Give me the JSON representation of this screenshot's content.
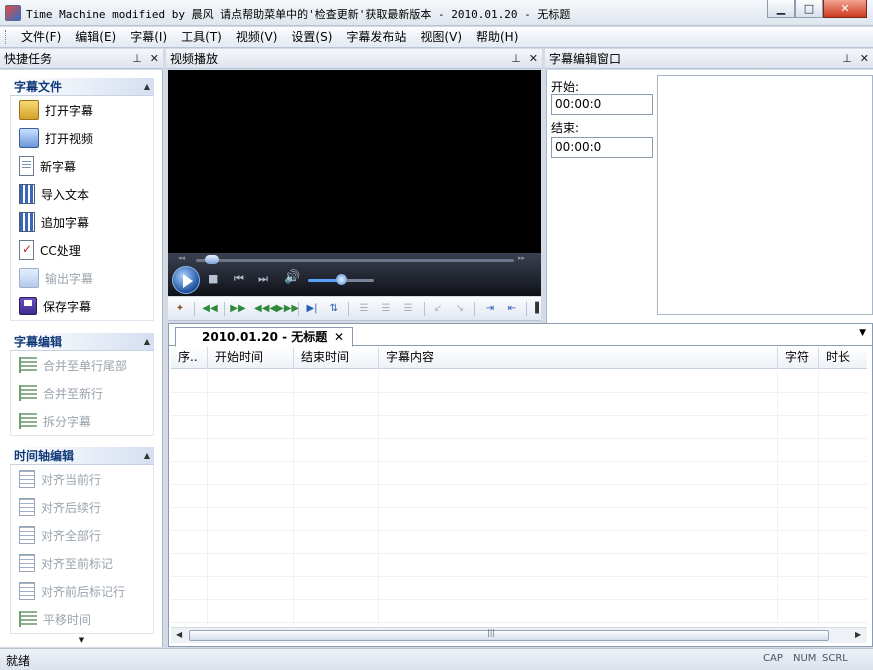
{
  "window": {
    "title": "Time Machine modified by 晨风 请点帮助菜单中的'检查更新'获取最新版本 - 2010.01.20 - 无标题"
  },
  "menu": [
    "文件(F)",
    "编辑(E)",
    "字幕(I)",
    "工具(T)",
    "视频(V)",
    "设置(S)",
    "字幕发布站",
    "视图(V)",
    "帮助(H)"
  ],
  "panes": {
    "tasks_title": "快捷任务",
    "video_title": "视频播放",
    "edit_title": "字幕编辑窗口"
  },
  "task_groups": [
    {
      "title": "字幕文件",
      "items": [
        {
          "label": "打开字幕",
          "icon": "open-subtitle-icon",
          "enabled": true
        },
        {
          "label": "打开视频",
          "icon": "open-video-icon",
          "enabled": true
        },
        {
          "label": "新字幕",
          "icon": "new-subtitle-icon",
          "enabled": true
        },
        {
          "label": "导入文本",
          "icon": "import-text-icon",
          "enabled": true
        },
        {
          "label": "追加字幕",
          "icon": "append-subtitle-icon",
          "enabled": true
        },
        {
          "label": "CC处理",
          "icon": "cc-process-icon",
          "enabled": true
        },
        {
          "label": "输出字幕",
          "icon": "export-subtitle-icon",
          "enabled": false
        },
        {
          "label": "保存字幕",
          "icon": "save-icon",
          "enabled": true
        }
      ]
    },
    {
      "title": "字幕编辑",
      "items": [
        {
          "label": "合并至单行尾部",
          "icon": "merge-line-end-icon",
          "enabled": false
        },
        {
          "label": "合并至新行",
          "icon": "merge-new-line-icon",
          "enabled": false
        },
        {
          "label": "拆分字幕",
          "icon": "split-subtitle-icon",
          "enabled": false
        }
      ]
    },
    {
      "title": "时间轴编辑",
      "items": [
        {
          "label": "对齐当前行",
          "icon": "align-current-icon",
          "enabled": false
        },
        {
          "label": "对齐后续行",
          "icon": "align-following-icon",
          "enabled": false
        },
        {
          "label": "对齐全部行",
          "icon": "align-all-icon",
          "enabled": false
        },
        {
          "label": "对齐至前标记",
          "icon": "align-prev-mark-icon",
          "enabled": false
        },
        {
          "label": "对齐前后标记行",
          "icon": "align-marks-icon",
          "enabled": false
        },
        {
          "label": "平移时间",
          "icon": "shift-time-icon",
          "enabled": false
        }
      ]
    }
  ],
  "edit_window": {
    "start_label": "开始:",
    "start_value": "00:00:0",
    "end_label": "结束:",
    "end_value": "00:00:0"
  },
  "video": {
    "seek_progress": 0.03,
    "volume": 0.5
  },
  "document": {
    "tab_title": "2010.01.20 - 无标题",
    "columns": [
      "序..",
      "开始时间",
      "结束时间",
      "字幕内容",
      "字符",
      "时长"
    ]
  },
  "status": {
    "text": "就绪",
    "indicators": [
      "CAP",
      "NUM",
      "SCRL"
    ]
  }
}
